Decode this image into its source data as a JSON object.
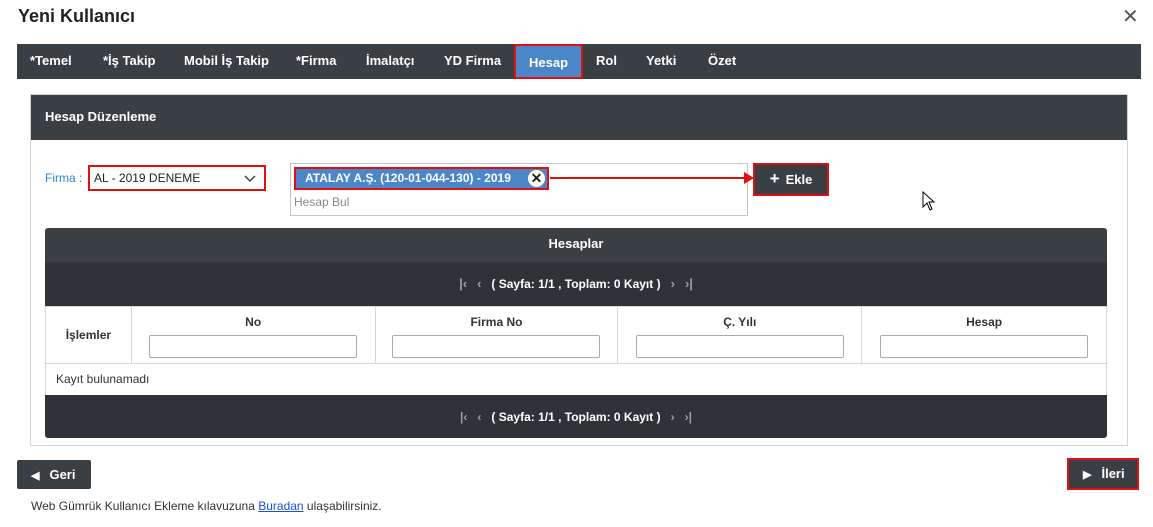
{
  "dialog": {
    "title": "Yeni Kullanıcı",
    "close_glyph": "✕"
  },
  "tabs": [
    {
      "label": "*Temel",
      "active": false
    },
    {
      "label": "*İş Takip",
      "active": false
    },
    {
      "label": "Mobil İş Takip",
      "active": false
    },
    {
      "label": "*Firma",
      "active": false
    },
    {
      "label": "İmalatçı",
      "active": false
    },
    {
      "label": "YD Firma",
      "active": false
    },
    {
      "label": "Hesap",
      "active": true
    },
    {
      "label": "Rol",
      "active": false
    },
    {
      "label": "Yetki",
      "active": false
    },
    {
      "label": "Özet",
      "active": false
    }
  ],
  "panel": {
    "title": "Hesap Düzenleme",
    "firma_label": "Firma :",
    "firma_value": "AL - 2019 DENEME",
    "selected_tag": "ATALAY A.Ş. (120-01-044-130) - 2019",
    "search_placeholder": "Hesap Bul",
    "ekle_label": "Ekle"
  },
  "grid": {
    "title": "Hesaplar",
    "pager_text": "( Sayfa: 1/1 , Toplam: 0 Kayıt )",
    "columns": [
      "İşlemler",
      "No",
      "Firma No",
      "Ç. Yılı",
      "Hesap"
    ],
    "empty_text": "Kayıt bulunamadı"
  },
  "footer": {
    "back_label": "Geri",
    "next_label": "İleri",
    "note_prefix": "Web Gümrük Kullanıcı Ekleme kılavuzuna ",
    "note_link": "Buradan",
    "note_suffix": " ulaşabilirsiniz."
  },
  "colors": {
    "dark": "#3a3f44",
    "accent": "#4a86c8",
    "highlight": "#e01010",
    "label_blue": "#2a8ad8"
  }
}
